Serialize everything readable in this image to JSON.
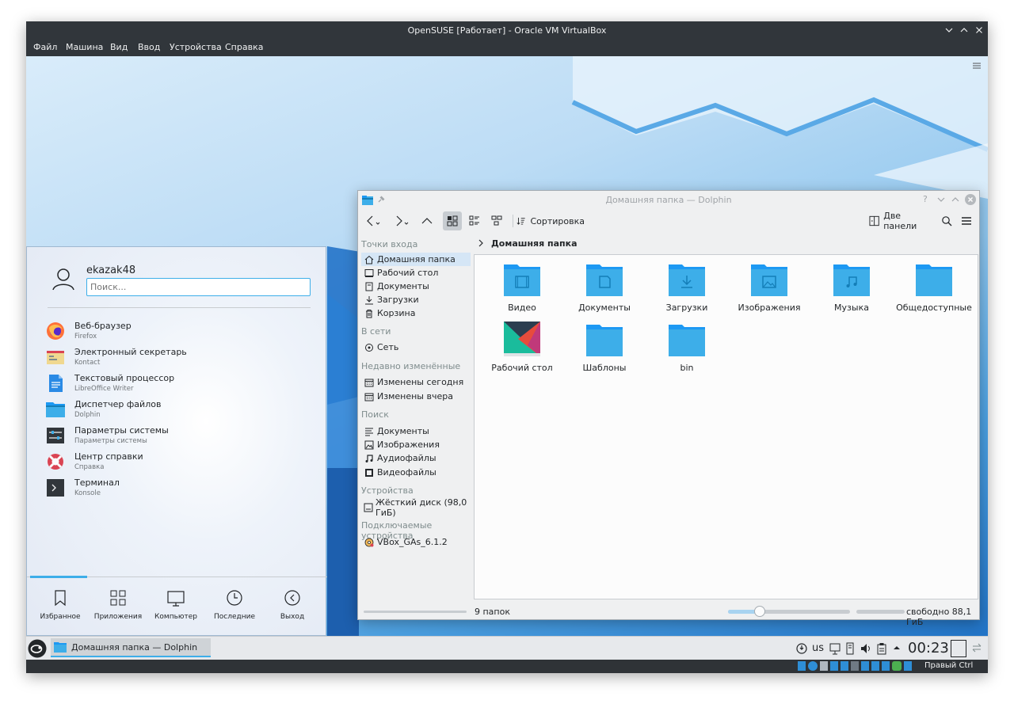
{
  "vbox": {
    "title": "OpenSUSE [Работает] - Oracle VM VirtualBox",
    "menu": [
      "Файл",
      "Машина",
      "Вид",
      "Ввод",
      "Устройства",
      "Справка"
    ],
    "host_key": "Правый Ctrl"
  },
  "dolphin": {
    "title": "Домашняя папка — Dolphin",
    "toolbar": {
      "sort_label": "Сортировка",
      "split_label": "Две панели"
    },
    "location": "Домашняя папка",
    "places": {
      "sections": [
        {
          "title": "Точки входа",
          "items": [
            {
              "label": "Домашняя папка",
              "icon": "home-icon"
            },
            {
              "label": "Рабочий стол",
              "icon": "desktop-icon"
            },
            {
              "label": "Документы",
              "icon": "documents-icon"
            },
            {
              "label": "Загрузки",
              "icon": "downloads-icon"
            },
            {
              "label": "Корзина",
              "icon": "trash-icon"
            }
          ]
        },
        {
          "title": "В сети",
          "items": [
            {
              "label": "Сеть",
              "icon": "network-icon"
            }
          ]
        },
        {
          "title": "Недавно изменённые",
          "items": [
            {
              "label": "Изменены сегодня",
              "icon": "calendar-icon"
            },
            {
              "label": "Изменены вчера",
              "icon": "calendar-icon"
            }
          ]
        },
        {
          "title": "Поиск",
          "items": [
            {
              "label": "Документы",
              "icon": "text-doc-icon"
            },
            {
              "label": "Изображения",
              "icon": "image-icon"
            },
            {
              "label": "Аудиофайлы",
              "icon": "music-note-icon"
            },
            {
              "label": "Видеофайлы",
              "icon": "film-icon"
            }
          ]
        },
        {
          "title": "Устройства",
          "items": [
            {
              "label": "Жёсткий диск (98,0 ГиБ)",
              "icon": "hard-disk-icon"
            }
          ]
        },
        {
          "title": "Подключаемые устройства",
          "items": [
            {
              "label": "VBox_GAs_6.1.2",
              "icon": "optical-disc-icon"
            }
          ]
        }
      ]
    },
    "files": [
      {
        "name": "Видео",
        "emblem": "film"
      },
      {
        "name": "Документы",
        "emblem": "document"
      },
      {
        "name": "Загрузки",
        "emblem": "download"
      },
      {
        "name": "Изображения",
        "emblem": "image"
      },
      {
        "name": "Музыка",
        "emblem": "music"
      },
      {
        "name": "Общедоступные",
        "emblem": "none"
      },
      {
        "name": "Рабочий стол",
        "emblem": "desktop"
      },
      {
        "name": "Шаблоны",
        "emblem": "none"
      },
      {
        "name": "bin",
        "emblem": "none"
      }
    ],
    "status": {
      "count": "9 папок",
      "free": "свободно 88,1 ГиБ"
    }
  },
  "kickoff": {
    "username": "ekazak48",
    "search_placeholder": "Поиск...",
    "favorites": [
      {
        "name": "Веб-браузер",
        "generic": "Firefox",
        "icon": "firefox-icon"
      },
      {
        "name": "Электронный секретарь",
        "generic": "Kontact",
        "icon": "kontact-icon"
      },
      {
        "name": "Текстовый процессор",
        "generic": "LibreOffice Writer",
        "icon": "writer-icon"
      },
      {
        "name": "Диспетчер файлов",
        "generic": "Dolphin",
        "icon": "dolphin-icon"
      },
      {
        "name": "Параметры системы",
        "generic": "Параметры системы",
        "icon": "settings-icon"
      },
      {
        "name": "Центр справки",
        "generic": "Справка",
        "icon": "help-icon"
      },
      {
        "name": "Терминал",
        "generic": "Konsole",
        "icon": "terminal-icon"
      }
    ],
    "tabs": [
      "Избранное",
      "Приложения",
      "Компьютер",
      "Последние",
      "Выход"
    ]
  },
  "taskbar": {
    "task": "Домашняя папка — Dolphin",
    "keyboard_layout": "us",
    "clock": "00:23"
  },
  "colors": {
    "accent": "#3daee9",
    "folder": "#3daee9",
    "panel": "#e7e9ec"
  }
}
